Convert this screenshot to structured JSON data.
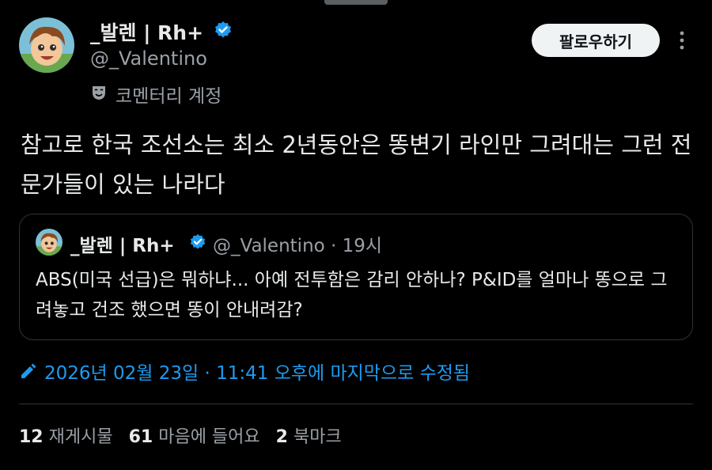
{
  "author": {
    "display_name": "_발렌 | Rh+",
    "handle": "@_Valentino",
    "account_label": "코멘터리 계정",
    "avatar_icon": "cartoon-child-avatar",
    "verified_icon": "verified-badge-icon"
  },
  "actions": {
    "follow_label": "팔로우하기",
    "more_icon": "more-vertical-icon"
  },
  "tweet": {
    "text": "참고로 한국 조선소는 최소 2년동안은 똥변기 라인만 그려대는 그런 전문가들이 있는 나라다"
  },
  "quote": {
    "display_name": "_발렌 | Rh+",
    "handle_time": "@_Valentino · 19시",
    "text": "ABS(미국 선급)은 뭐하냐... 아예 전투함은 감리 안하나? P&ID를 얼마나 똥으로 그려놓고 건조 했으면 똥이 안내려감?"
  },
  "edited": {
    "text": "2026년 02월 23일 · 11:41 오후에 마지막으로 수정됨",
    "icon": "pencil-icon"
  },
  "stats": {
    "reposts_count": "12",
    "reposts_label": "재게시물",
    "likes_count": "61",
    "likes_label": "마음에 들어요",
    "bookmarks_count": "2",
    "bookmarks_label": "북마크"
  },
  "colors": {
    "background": "#000000",
    "text": "#e7e9ea",
    "muted": "#9aa0a6",
    "accent": "#1d9bf0",
    "border": "#2f3336"
  }
}
